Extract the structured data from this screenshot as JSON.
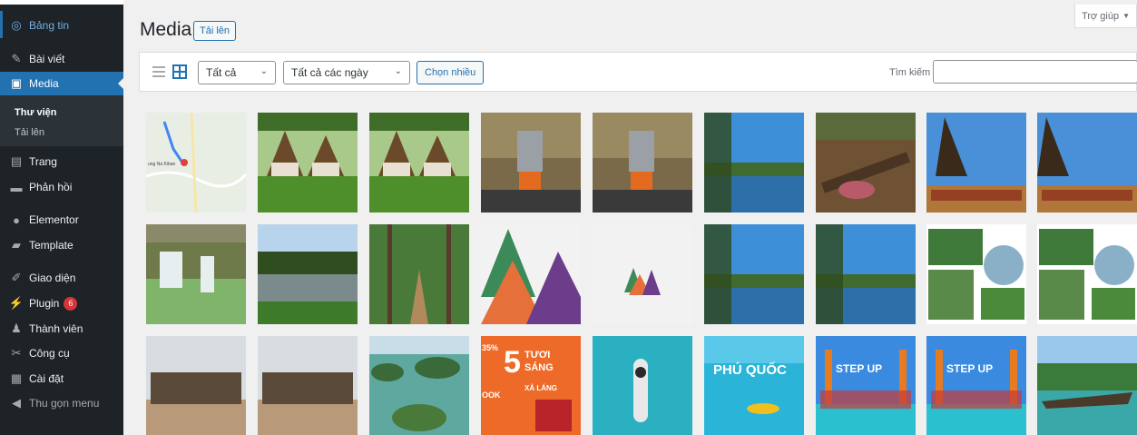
{
  "sidebar": {
    "items": [
      {
        "label": "Bảng tin",
        "icon": "dashboard-icon"
      },
      {
        "label": "Bài viết",
        "icon": "pin-icon"
      },
      {
        "label": "Media",
        "icon": "media-icon"
      },
      {
        "label": "Trang",
        "icon": "page-icon"
      },
      {
        "label": "Phản hồi",
        "icon": "comment-icon"
      },
      {
        "label": "Elementor",
        "icon": "elementor-icon"
      },
      {
        "label": "Template",
        "icon": "folder-icon"
      },
      {
        "label": "Giao diện",
        "icon": "brush-icon"
      },
      {
        "label": "Plugin",
        "icon": "plug-icon",
        "badge": "6"
      },
      {
        "label": "Thành viên",
        "icon": "user-icon"
      },
      {
        "label": "Công cụ",
        "icon": "wrench-icon"
      },
      {
        "label": "Cài đặt",
        "icon": "settings-icon"
      },
      {
        "label": "Thu gọn menu",
        "icon": "collapse-icon"
      }
    ],
    "submenu": [
      {
        "label": "Thư viện"
      },
      {
        "label": "Tải lên"
      }
    ]
  },
  "header": {
    "title": "Media",
    "upload_label": "Tải lên",
    "help_label": "Trợ giúp"
  },
  "toolbar": {
    "type_filter": "Tất cả",
    "date_filter": "Tất cả các ngày",
    "bulk_select_label": "Chọn nhiều",
    "search_label": "Tìm kiếm",
    "search_value": ""
  },
  "colors": {
    "sidebar_bg": "#1d2327",
    "accent": "#2271b1",
    "badge": "#d63638"
  },
  "media_grid": {
    "rows": 3,
    "columns": 9,
    "items": [
      {
        "subject": "map"
      },
      {
        "subject": "bungalow"
      },
      {
        "subject": "bungalow"
      },
      {
        "subject": "coffee-pot"
      },
      {
        "subject": "coffee-pot"
      },
      {
        "subject": "lake"
      },
      {
        "subject": "campfire"
      },
      {
        "subject": "longhouse"
      },
      {
        "subject": "longhouse"
      },
      {
        "subject": "waterfall"
      },
      {
        "subject": "lake-forest"
      },
      {
        "subject": "pine-path"
      },
      {
        "subject": "logo-large"
      },
      {
        "subject": "logo-small"
      },
      {
        "subject": "lake"
      },
      {
        "subject": "lake"
      },
      {
        "subject": "collage"
      },
      {
        "subject": "collage"
      },
      {
        "subject": "elephants"
      },
      {
        "subject": "elephants"
      },
      {
        "subject": "bay"
      },
      {
        "subject": "promo"
      },
      {
        "subject": "paddleboard"
      },
      {
        "subject": "kayak"
      },
      {
        "subject": "stepup"
      },
      {
        "subject": "stepup"
      },
      {
        "subject": "boat"
      }
    ],
    "tile_texts": {
      "map_label": "ung Na Kiban",
      "promo_big": "5",
      "promo_word1": "TƯƠI",
      "promo_word2": "SÁNG",
      "promo_percent": "35%",
      "promo_xalang": "XẢ LÁNG",
      "promo_ook": "OOK",
      "kayak_text": "PHÚ QUỐC",
      "stepup_text": "STEP UP"
    }
  }
}
